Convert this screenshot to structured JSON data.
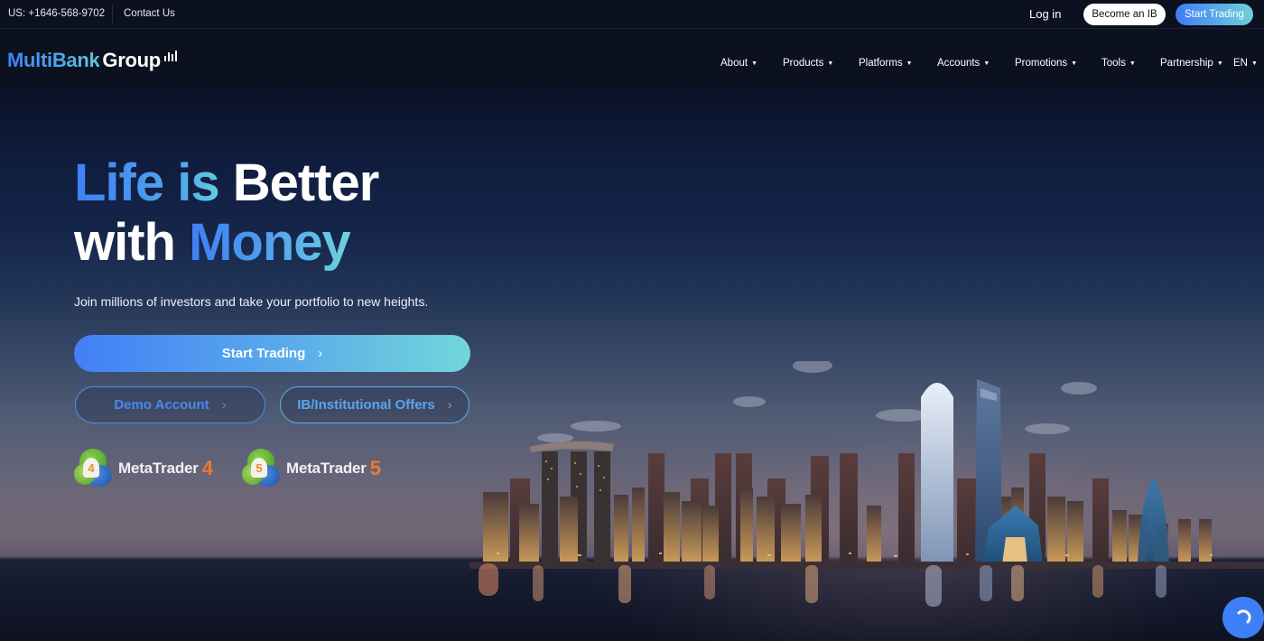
{
  "topbar": {
    "phone": "US: +1646-568-9702",
    "contact_label": "Contact Us",
    "login_label": "Log in",
    "become_ib_label": "Become an IB",
    "start_trading_label": "Start Trading"
  },
  "brand": {
    "name_part1": "MultiBank",
    "name_part2": "Group",
    "icon": "bar-chart-icon",
    "accent_start": "#3f7ff5",
    "accent_end": "#6fd0d8"
  },
  "nav": {
    "items": [
      {
        "label": "About",
        "icon": "caret-down-icon"
      },
      {
        "label": "Products",
        "icon": "caret-down-icon"
      },
      {
        "label": "Platforms",
        "icon": "caret-down-icon"
      },
      {
        "label": "Accounts",
        "icon": "caret-down-icon"
      },
      {
        "label": "Promotions",
        "icon": "caret-down-icon"
      },
      {
        "label": "Tools",
        "icon": "caret-down-icon"
      },
      {
        "label": "Partnership",
        "icon": "caret-down-icon"
      },
      {
        "label": "EN",
        "icon": "caret-down-icon"
      }
    ]
  },
  "hero": {
    "headline": {
      "w1": "Life",
      "w2": "is",
      "w3": "Better",
      "w4": "with",
      "w5": "Money"
    },
    "subtitle": "Join millions of investors and take your portfolio to new heights.",
    "primary_cta": "Start Trading",
    "demo_cta": "Demo Account",
    "ib_cta": "IB/Institutional Offers",
    "chevron": "›",
    "platforms": [
      {
        "name": "MetaTrader",
        "version": "4",
        "icon": "metatrader-4-icon"
      },
      {
        "name": "MetaTrader",
        "version": "5",
        "icon": "metatrader-5-icon"
      }
    ]
  },
  "chat": {
    "icon": "chat-loading-icon",
    "color": "#3f7ff5"
  }
}
